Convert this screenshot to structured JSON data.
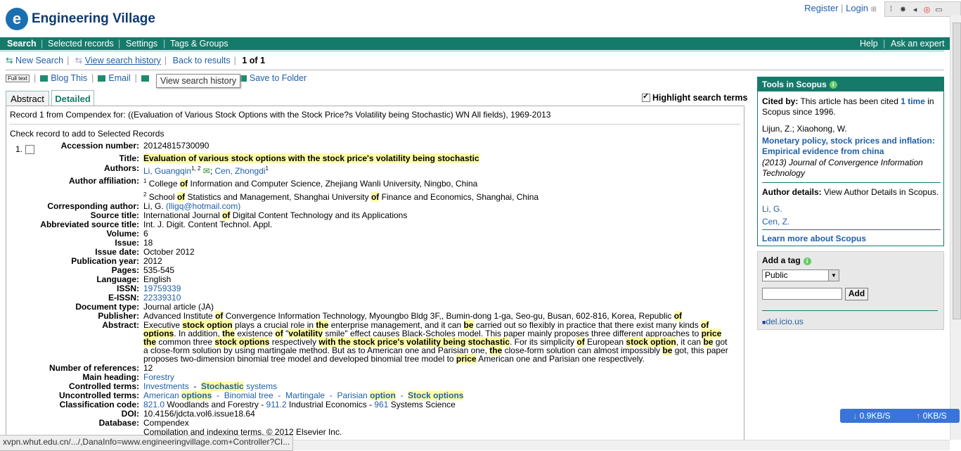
{
  "header": {
    "brand": "Engineering Village",
    "register": "Register",
    "login": "Login"
  },
  "nav": [
    "Search",
    "Selected records",
    "Settings",
    "Tags & Groups"
  ],
  "nav_right": [
    "Help",
    "Ask an expert"
  ],
  "subnav": {
    "new_search": "New Search",
    "view_history": "View search history",
    "back": "Back to results",
    "count": "1 of 1"
  },
  "toolbar": {
    "fulltext": "Full text",
    "blog": "Blog This",
    "email": "Email",
    "save": "Save to Folder",
    "tooltip": "View search history"
  },
  "tabs": [
    "Abstract",
    "Detailed"
  ],
  "highlight_label": "Highlight search terms",
  "record": {
    "query": "Record 1 from Compendex for: ((Evaluation of Various Stock Options with the Stock Price?s Volatility being Stochastic) WN All fields), 1969-2013",
    "check_instruction": "Check record to add to Selected Records",
    "number": "1."
  },
  "fields": {
    "accession_label": "Accession number:",
    "accession": "20124815730090",
    "title_label": "Title:",
    "title": "Evaluation of various stock options with the stock price's volatility being stochastic",
    "authors_label": "Authors:",
    "author1": "Li, Guangqin",
    "author1_sup": "1, 2",
    "author2": "Cen, Zhongdi",
    "author2_sup": "1",
    "affil_label": "Author affiliation:",
    "affil1_a": "College ",
    "affil1_of": "of",
    "affil1_b": " Information and Computer Science, Zhejiang Wanli University, Ningbo, China",
    "affil2_a": "School ",
    "affil2_of": "of",
    "affil2_b": " Statistics and Management, Shanghai University ",
    "affil2_of2": "of",
    "affil2_c": " Finance and Economics, Shanghai, China",
    "corr_label": "Corresponding author:",
    "corr": "Li, G.",
    "corr_email": "(lligq@hotmail.com)",
    "source_label": "Source title:",
    "source_a": "International Journal ",
    "source_of": "of",
    "source_b": " Digital Content Technology and its Applications",
    "abbr_label": "Abbreviated source title:",
    "abbr": "Int. J. Digit. Content Technol. Appl.",
    "volume_label": "Volume:",
    "volume": "6",
    "issue_label": "Issue:",
    "issue": "18",
    "date_label": "Issue date:",
    "date": "October 2012",
    "year_label": "Publication year:",
    "year": "2012",
    "pages_label": "Pages:",
    "pages": "535-545",
    "lang_label": "Language:",
    "lang": "English",
    "issn_label": "ISSN:",
    "issn": "19759339",
    "eissn_label": "E-ISSN:",
    "eissn": "22339310",
    "doctype_label": "Document type:",
    "doctype": "Journal article (JA)",
    "publisher_label": "Publisher:",
    "publisher_a": "Advanced Institute ",
    "publisher_of": "of",
    "publisher_b": " Convergence Information Technology, Myoungbo Bldg 3F,, Bumin-dong 1-ga, Seo-gu, Busan, 602-816, Korea, Republic ",
    "publisher_of2": "of",
    "abstract_label": "Abstract:",
    "refs_label": "Number of references:",
    "refs": "12",
    "heading_label": "Main heading:",
    "heading": "Forestry",
    "controlled_label": "Controlled terms:",
    "ct1": "Investments",
    "ct2a": "Stochastic",
    "ct2b": " systems",
    "uncontrolled_label": "Uncontrolled terms:",
    "ut1a": "American ",
    "ut1b": "options",
    "ut2": "Binomial tree",
    "ut3": "Martingale",
    "ut4a": "Parisian ",
    "ut4b": "option",
    "ut5": "Stock options",
    "class_label": "Classification code:",
    "cc1": "821.0",
    "cc1t": " Woodlands and Forestry - ",
    "cc2": "911.2",
    "cc2t": " Industrial Economics - ",
    "cc3": "961",
    "cc3t": " Systems Science",
    "doi_label": "DOI:",
    "doi": "10.4156/jdcta.vol6.issue18.64",
    "db_label": "Database:",
    "db": "Compendex",
    "copyright": "Compilation and indexing terms, © 2012 Elsevier Inc."
  },
  "scopus": {
    "header": "Tools in Scopus",
    "cited_bold": "Cited by:",
    "cited_text": " This article has been cited ",
    "cited_link": "1 time",
    "cited_tail": " in Scopus since 1996.",
    "authors": "Lijun, Z.; Xiaohong, W.",
    "paper": "Monetary policy, stock prices and inflation: Empirical evidence from china",
    "journal": "(2013) Journal of Convergence Information Technology",
    "details_bold": "Author details:",
    "details_text": " View Author Details in Scopus.",
    "a1": "Li, G.",
    "a2": "Cen, Z.",
    "learn": "Learn more about Scopus"
  },
  "tags": {
    "title": "Add a tag",
    "select": "Public",
    "add": "Add",
    "delicious": "del.icio.us"
  },
  "status": "xvpn.whut.edu.cn/.../,DanaInfo=www.engineeringvillage.com+Controller?CI...",
  "speed": {
    "down": "0.9KB/S",
    "up": "0KB/S"
  },
  "colors": {
    "nav": "#167a6b",
    "link": "#1f5fa8",
    "highlight": "#fdfda6"
  }
}
